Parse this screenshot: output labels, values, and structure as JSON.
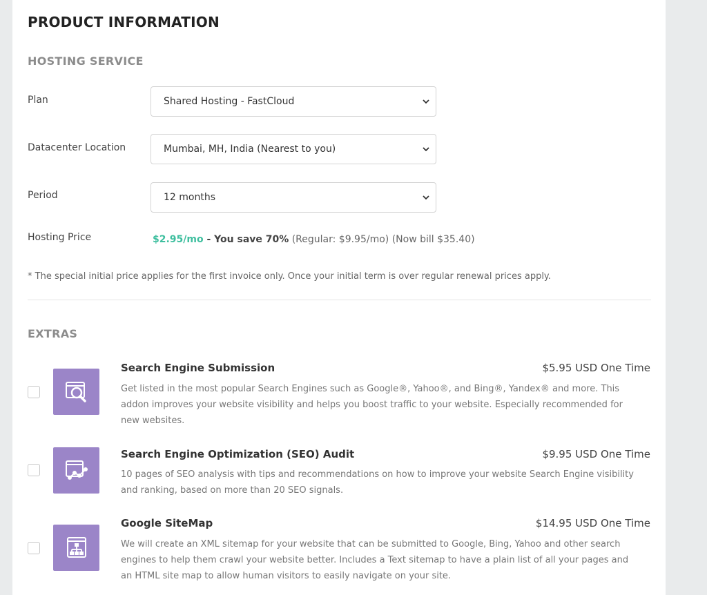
{
  "page": {
    "title": "PRODUCT INFORMATION"
  },
  "hosting": {
    "section_title": "HOSTING SERVICE",
    "plan_label": "Plan",
    "plan_value": "Shared Hosting - FastCloud",
    "location_label": "Datacenter Location",
    "location_value": "Mumbai, MH, India (Nearest to you)",
    "period_label": "Period",
    "period_value": "12 months",
    "price_label": "Hosting Price",
    "price_main": "$2.95/mo",
    "price_save": " - You save 70%",
    "price_regular": " (Regular: $9.95/mo) (Now bill $35.40)",
    "note": "* The special initial price applies for the first invoice only. Once your initial term is over regular renewal prices apply."
  },
  "extras": {
    "section_title": "EXTRAS",
    "items": [
      {
        "name": "Search Engine Submission",
        "price": "$5.95 USD One Time",
        "desc_lines": [
          "Get listed in the most popular Search Engines such as Google®, Yahoo®, and Bing®, Yandex® and more. This",
          "addon improves your website visibility and helps you boost traffic to your website. Especially recommended for",
          "new websites."
        ],
        "icon": "search-magnifier-icon",
        "checked": false
      },
      {
        "name": "Search Engine Optimization (SEO) Audit",
        "price": "$9.95 USD One Time",
        "desc_lines": [
          "10 pages of SEO analysis with tips and recommendations on how to improve your website Search Engine visibility",
          "and ranking, based on more than 20 SEO signals."
        ],
        "icon": "seo-chart-icon",
        "checked": false
      },
      {
        "name": "Google SiteMap",
        "price": "$14.95 USD One Time",
        "desc_lines": [
          "We will create an XML sitemap for your website that can be submitted to Google, Bing, Yahoo and other search",
          "engines to help them crawl your website better. Includes a Text sitemap to have a plain list of all your pages and",
          "an HTML site map to allow human visitors to easily navigate on your site."
        ],
        "icon": "sitemap-icon",
        "checked": false
      }
    ]
  },
  "colors": {
    "accent_green": "#3fbf9f",
    "icon_purple": "#9b85c8",
    "background": "#e9ebec"
  }
}
